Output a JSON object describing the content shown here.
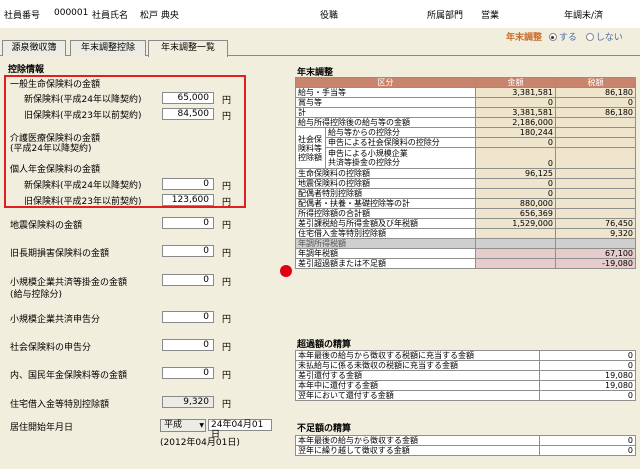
{
  "header": {
    "emp_no_label": "社員番号",
    "emp_no": "000001",
    "emp_name_label": "社員氏名",
    "emp_name": "松戸 典央",
    "position_label": "役職",
    "dept_label": "所属部門",
    "dept": "営業",
    "nencho_label": "年調未/済",
    "adj_label": "年末調整",
    "opt_yes": "する",
    "opt_no": "しない"
  },
  "tabs": [
    "源泉徴収簿",
    "年末調整控除",
    "年末調整一覧"
  ],
  "left": {
    "section_title": "控除情報",
    "life_ins_title": "一般生命保険料の金額",
    "new_ins_label": "新保険料(平成24年以降契約)",
    "new_ins_val": "65,000",
    "old_ins_label": "旧保険料(平成23年以前契約)",
    "old_ins_val": "84,500",
    "care_label": "介護医療保険料の金額",
    "care_sub": "(平成24年以降契約)",
    "pension_title": "個人年金保険料の金額",
    "p_new_label": "新保険料(平成24年以降契約)",
    "p_new_val": "0",
    "p_old_label": "旧保険料(平成23年以前契約)",
    "p_old_val": "123,600",
    "quake_label": "地震保険料の金額",
    "quake_val": "0",
    "longterm_label": "旧長期損害保険料の金額",
    "longterm_val": "0",
    "smallbiz_label": "小規模企業共済等掛金の金額",
    "smallbiz_sub": "(給与控除分)",
    "smallbiz_val": "0",
    "smallbiz_decl_label": "小規模企業共済申告分",
    "smallbiz_decl_val": "0",
    "social_decl_label": "社会保険料の申告分",
    "social_decl_val": "0",
    "nenkin_label": "内、国民年金保険料等の金額",
    "nenkin_val": "0",
    "housing_label": "住宅借入金等特別控除額",
    "housing_val": "9,320",
    "residence_label": "居住開始年月日",
    "era": "平成",
    "res_date": "24年04月01日",
    "res_western": "(2012年04月01日)",
    "yen": "円"
  },
  "right": {
    "title": "年末調整",
    "cols": [
      "区分",
      "金額",
      "税額"
    ],
    "r1": [
      "給与・手当等",
      "3,381,581",
      "86,180"
    ],
    "r2": [
      "賞与等",
      "0",
      "0"
    ],
    "r3": [
      "計",
      "3,381,581",
      "86,180"
    ],
    "r4": [
      "給与所得控除後の給与等の金額",
      "2,186,000"
    ],
    "r5_group": "社会保険料等控除額",
    "r5a": [
      "給与等からの控除分",
      "180,244"
    ],
    "r5b": [
      "申告による社会保険料の控除分",
      "0"
    ],
    "r5c_1": "申告による小規模企業",
    "r5c_2": "共済等掛金の控除分",
    "r5c_v": "0",
    "r6": [
      "生命保険料の控除額",
      "96,125"
    ],
    "r7": [
      "地震保険料の控除額",
      "0"
    ],
    "r8": [
      "配偶者特別控除額",
      "0"
    ],
    "r9": [
      "配偶者・扶養・基礎控除等の計",
      "880,000"
    ],
    "r10": [
      "所得控除額の合計額",
      "656,369"
    ],
    "r11": [
      "差引課税給与所得金額及び年税額",
      "1,529,000",
      "76,450"
    ],
    "r12": [
      "住宅借入金等特別控除額",
      "9,320"
    ],
    "r13": [
      "年調所得税額"
    ],
    "r14": [
      "年調年税額",
      "67,100"
    ],
    "r15": [
      "差引超過額または不足額",
      "-19,080"
    ],
    "excess_title": "超過額の精算",
    "e1": [
      "本年最後の給与から徴収する税額に充当する金額",
      "0"
    ],
    "e2": [
      "未払給与に係る未徴収の税額に充当する金額",
      "0"
    ],
    "e3": [
      "差引還付する金額",
      "19,080"
    ],
    "e4": [
      "本年中に還付する金額",
      "19,080"
    ],
    "e5": [
      "翌年において還付する金額",
      "0"
    ],
    "short_title": "不足額の精算",
    "s1": [
      "本年最後の給与から徴収する金額",
      "0"
    ],
    "s2": [
      "翌年に繰り越して徴収する金額",
      "0"
    ]
  }
}
